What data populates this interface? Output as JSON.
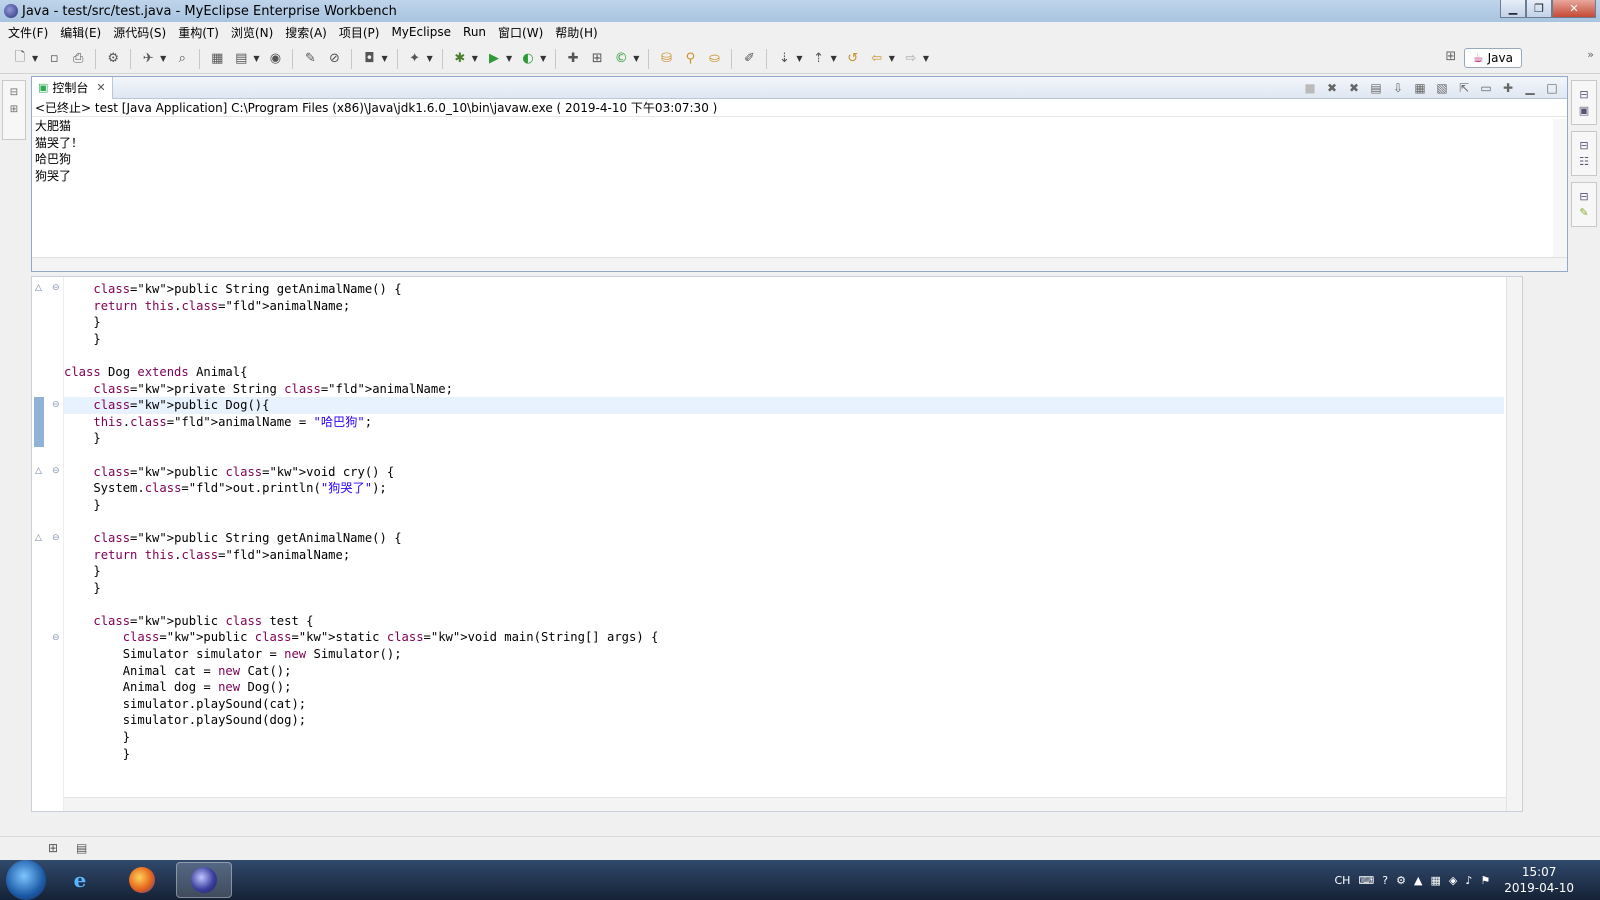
{
  "window": {
    "title": "Java  -  test/src/test.java  -  MyEclipse Enterprise Workbench",
    "min_icon": "minimize-icon",
    "max_icon": "restore-icon",
    "close_icon": "close-icon"
  },
  "menu": [
    "文件(F)",
    "编辑(E)",
    "源代码(S)",
    "重构(T)",
    "浏览(N)",
    "搜索(A)",
    "项目(P)",
    "MyEclipse",
    "Run",
    "窗口(W)",
    "帮助(H)"
  ],
  "perspective": {
    "label": "Java"
  },
  "console": {
    "tab_label": "控制台",
    "header": "<已终止> test [Java Application] C:\\Program Files (x86)\\Java\\jdk1.6.0_10\\bin\\javaw.exe ( 2019-4-10 下午03:07:30 )",
    "output": [
      "大肥猫",
      "猫哭了！",
      "哈巴狗",
      "狗哭了"
    ]
  },
  "editor": {
    "lines": [
      "    public String getAnimalName() {",
      "    return this.animalName;",
      "    }",
      "    }",
      "",
      "class Dog extends Animal{",
      "    private String animalName;",
      "    public Dog(){",
      "    this.animalName = \"哈巴狗\";",
      "    }",
      "",
      "    public void cry() {",
      "    System.out.println(\"狗哭了\");",
      "    }",
      "",
      "    public String getAnimalName() {",
      "    return this.animalName;",
      "    }",
      "    }",
      "",
      "    public class test {",
      "        public static void main(String[] args) {",
      "        Simulator simulator = new Simulator();",
      "        Animal cat = new Cat();",
      "        Animal dog = new Dog();",
      "        simulator.playSound(cat);",
      "        simulator.playSound(dog);",
      "        }",
      "        }"
    ],
    "current_line_index": 7
  },
  "taskbar": {
    "tray_lang": "CH",
    "time": "15:07",
    "date": "2019-04-10"
  }
}
